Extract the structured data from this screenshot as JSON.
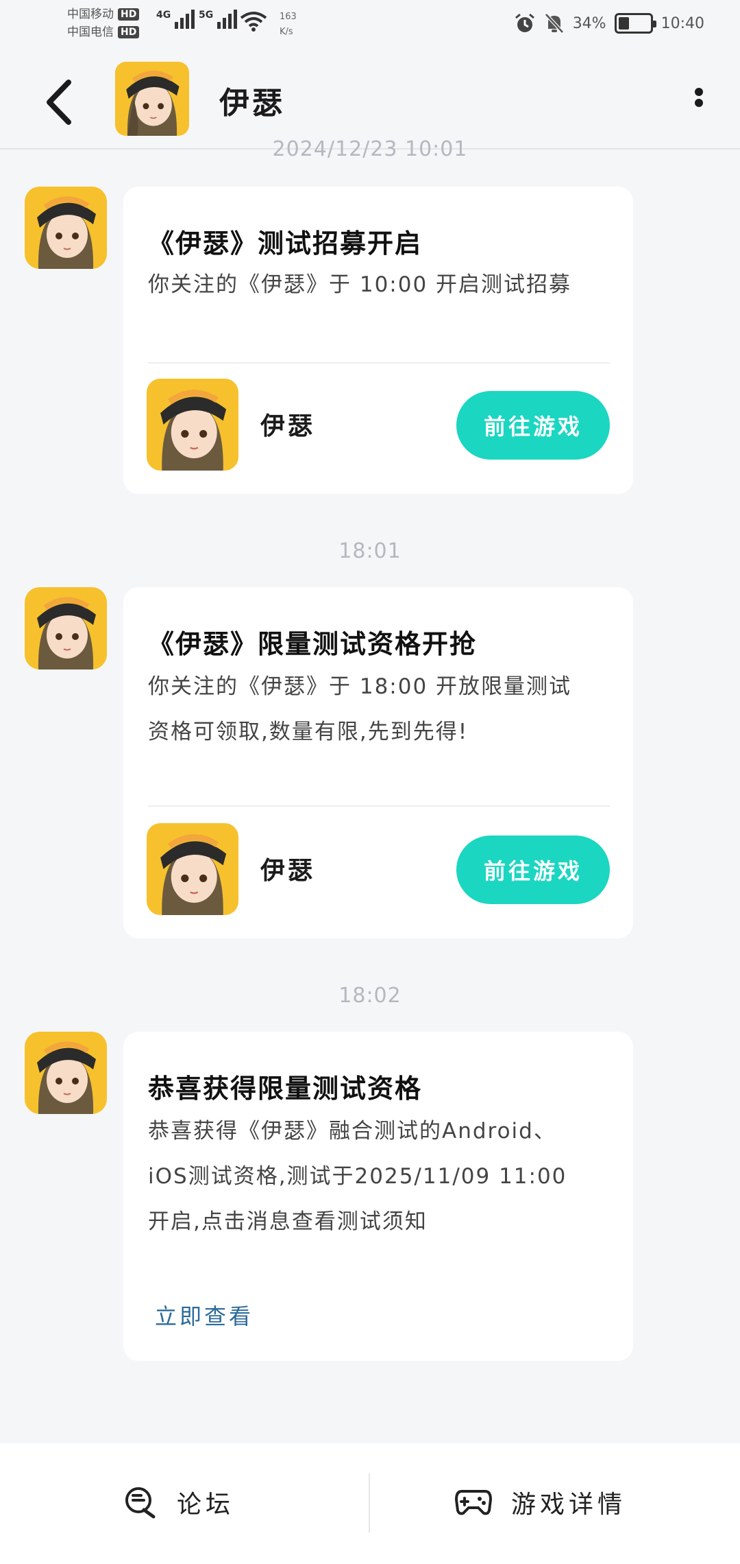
{
  "status_bar": {
    "carrier_1": "中国移动",
    "carrier_2": "中国电信",
    "hd": "HD",
    "net_1": "4G",
    "net_2": "5G",
    "speed_value": "163",
    "speed_unit": "K/s",
    "battery_text": "34%",
    "battery_level": 0.34,
    "time": "10:40"
  },
  "header": {
    "title": "伊瑟"
  },
  "messages": [
    {
      "timestamp": "2024/12/23 10:01",
      "title": "《伊瑟》测试招募开启",
      "body": "你关注的《伊瑟》于 10:00 开启测试招募",
      "game_name": "伊瑟",
      "button": "前往游戏"
    },
    {
      "timestamp": "18:01",
      "title": "《伊瑟》限量测试资格开抢",
      "body": "你关注的《伊瑟》于 18:00 开放限量测试资格可领取,数量有限,先到先得!",
      "game_name": "伊瑟",
      "button": "前往游戏"
    },
    {
      "timestamp": "18:02",
      "title": "恭喜获得限量测试资格",
      "body": "恭喜获得《伊瑟》融合测试的Android、iOS测试资格,测试于2025/11/09 11:00 开启,点击消息查看测试须知",
      "link": "立即查看"
    }
  ],
  "bottom_bar": {
    "forum": "论坛",
    "game_details": "游戏详情"
  },
  "colors": {
    "accent": "#1bd6c1",
    "link": "#2b6a9a",
    "background": "#f5f6f8"
  }
}
